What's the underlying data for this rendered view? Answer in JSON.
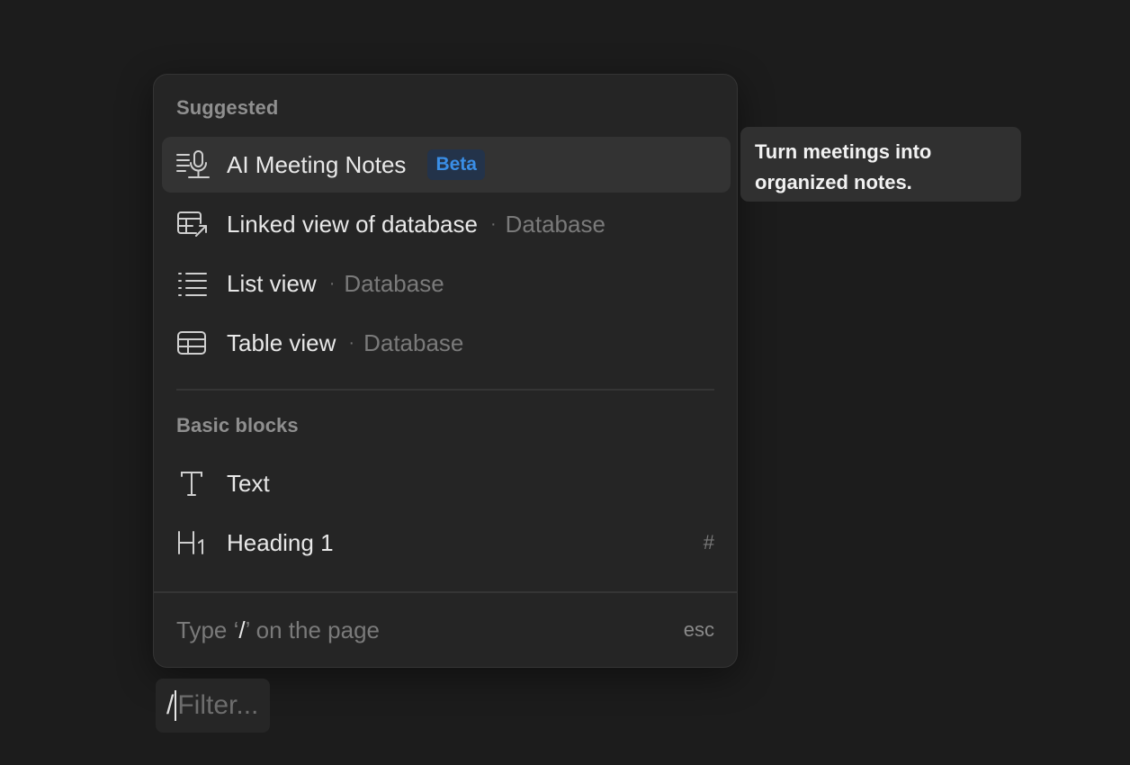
{
  "menu": {
    "sections": [
      {
        "title": "Suggested",
        "items": [
          {
            "label": "AI Meeting Notes",
            "badge": "Beta",
            "icon": "meeting-notes-icon"
          },
          {
            "label": "Linked view of database",
            "sub": "Database",
            "icon": "linked-database-icon"
          },
          {
            "label": "List view",
            "sub": "Database",
            "icon": "list-icon"
          },
          {
            "label": "Table view",
            "sub": "Database",
            "icon": "table-icon"
          }
        ]
      },
      {
        "title": "Basic blocks",
        "items": [
          {
            "label": "Text",
            "icon": "text-icon"
          },
          {
            "label": "Heading 1",
            "shortcut": "#",
            "icon": "heading-1-icon"
          }
        ]
      }
    ],
    "separator": "·",
    "footer": {
      "hint_before": "Type ‘",
      "hint_slash": "/",
      "hint_after": "’ on the page",
      "esc": "esc"
    }
  },
  "tooltip": {
    "text": "Turn meetings into organized notes."
  },
  "filter": {
    "prefix": "/",
    "placeholder": "Filter..."
  }
}
